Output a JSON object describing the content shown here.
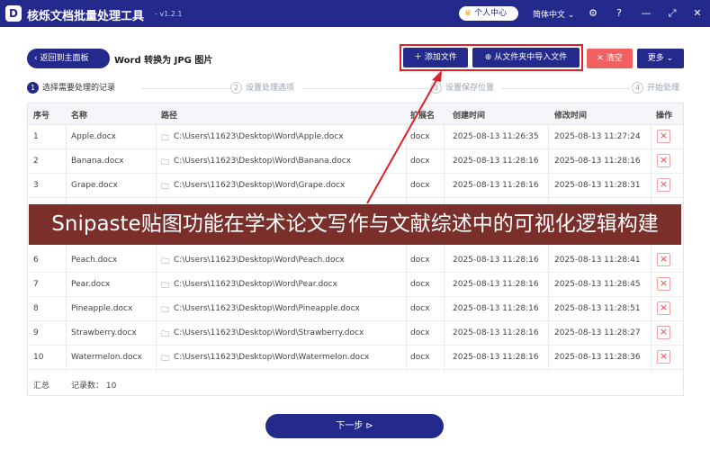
{
  "titlebar": {
    "logo": "D",
    "app_title": "核烁文档批量处理工具",
    "version": "- v1.2.1",
    "user_center": "个人中心",
    "language": "简体中文 ⌄",
    "icons": [
      "gear-icon",
      "help-icon",
      "minimize-icon",
      "maximize-icon",
      "close-icon"
    ]
  },
  "toolbar": {
    "back_label": "返回到主面板",
    "page_title": "Word 转换为 JPG 图片",
    "add_file": "添加文件",
    "import_folder": "从文件夹中导入文件",
    "clear": "清空",
    "more": "更多"
  },
  "steps": [
    {
      "num": "1",
      "label": "选择需要处理的记录",
      "active": true
    },
    {
      "num": "2",
      "label": "设置处理选项",
      "active": false
    },
    {
      "num": "3",
      "label": "设置保存位置",
      "active": false
    },
    {
      "num": "4",
      "label": "开始处理",
      "active": false
    }
  ],
  "table": {
    "headers": [
      "序号",
      "名称",
      "路径",
      "扩展名",
      "创建时间",
      "修改时间",
      "操作"
    ],
    "rows": [
      {
        "index": "1",
        "name": "Apple.docx",
        "path": "C:\\Users\\11623\\Desktop\\Word\\Apple.docx",
        "ext": "docx",
        "created": "2025-08-13 11:26:35",
        "modified": "2025-08-13 11:27:24"
      },
      {
        "index": "2",
        "name": "Banana.docx",
        "path": "C:\\Users\\11623\\Desktop\\Word\\Banana.docx",
        "ext": "docx",
        "created": "2025-08-13 11:28:16",
        "modified": "2025-08-13 11:28:16"
      },
      {
        "index": "3",
        "name": "Grape.docx",
        "path": "C:\\Users\\11623\\Desktop\\Word\\Grape.docx",
        "ext": "docx",
        "created": "2025-08-13 11:28:16",
        "modified": "2025-08-13 11:28:31"
      },
      {
        "index": "6",
        "name": "Peach.docx",
        "path": "C:\\Users\\11623\\Desktop\\Word\\Peach.docx",
        "ext": "docx",
        "created": "2025-08-13 11:28:16",
        "modified": "2025-08-13 11:28:41"
      },
      {
        "index": "7",
        "name": "Pear.docx",
        "path": "C:\\Users\\11623\\Desktop\\Word\\Pear.docx",
        "ext": "docx",
        "created": "2025-08-13 11:28:16",
        "modified": "2025-08-13 11:28:45"
      },
      {
        "index": "8",
        "name": "Pineapple.docx",
        "path": "C:\\Users\\11623\\Desktop\\Word\\Pineapple.docx",
        "ext": "docx",
        "created": "2025-08-13 11:28:16",
        "modified": "2025-08-13 11:28:51"
      },
      {
        "index": "9",
        "name": "Strawberry.docx",
        "path": "C:\\Users\\11623\\Desktop\\Word\\Strawberry.docx",
        "ext": "docx",
        "created": "2025-08-13 11:28:16",
        "modified": "2025-08-13 11:28:27"
      },
      {
        "index": "10",
        "name": "Watermelon.docx",
        "path": "C:\\Users\\11623\\Desktop\\Word\\Watermelon.docx",
        "ext": "docx",
        "created": "2025-08-13 11:28:16",
        "modified": "2025-08-13 11:28:36"
      }
    ],
    "summary_label": "汇总",
    "summary_count": "记录数： 10"
  },
  "banner": "Snipaste贴图功能在学术论文写作与文献综述中的可视化逻辑构建",
  "next_button": "下一步",
  "colors": {
    "primary": "#232a8c",
    "danger": "#f26161",
    "highlight": "#e0212b",
    "banner": "#7b2f2a"
  }
}
